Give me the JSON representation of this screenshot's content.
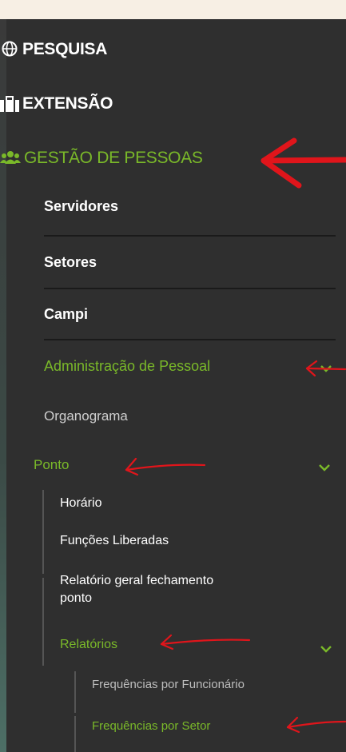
{
  "menu": {
    "pesquisa": "PESQUISA",
    "extensao": "EXTENSÃO",
    "gestao": "GESTÃO DE PESSOAS",
    "servidores": "Servidores",
    "setores": "Setores",
    "campi": "Campi",
    "admin_pessoal": "Administração de Pessoal",
    "organograma": "Organograma",
    "ponto": "Ponto",
    "horario": "Horário",
    "funcoes": "Funções Liberadas",
    "relatorio_geral": "Relatório geral fechamento",
    "relatorio_geral_2": "ponto",
    "relatorios": "Relatórios",
    "freq_funcionario": "Frequências por Funcionário",
    "freq_setor": "Frequências por Setor"
  },
  "icons": {
    "pesquisa": "globe-icon",
    "extensao": "suitcase-icon",
    "gestao": "users-icon",
    "expand": "chevron-down-icon",
    "annotation": "red-arrow"
  },
  "colors": {
    "green": "#7ab929",
    "panel": "#2f2f2f",
    "arrow": "#e0151b"
  }
}
